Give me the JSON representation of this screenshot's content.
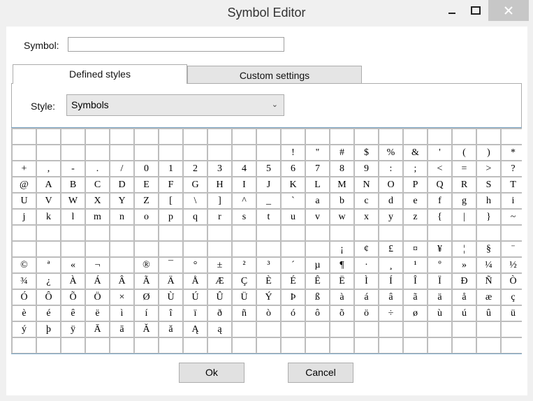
{
  "window": {
    "title": "Symbol Editor"
  },
  "symbol": {
    "label": "Symbol:",
    "value": ""
  },
  "tabs": [
    {
      "label": "Defined styles"
    },
    {
      "label": "Custom settings"
    }
  ],
  "style": {
    "label": "Style:",
    "selected": "Symbols"
  },
  "grid": {
    "rows": [
      [
        "",
        "",
        "",
        "",
        "",
        "",
        "",
        "",
        "",
        "",
        "",
        "",
        "",
        "",
        "",
        "",
        "",
        "",
        "",
        "",
        ""
      ],
      [
        "",
        "",
        "",
        "",
        "",
        "",
        "",
        "",
        "",
        "",
        "",
        "!",
        "\"",
        "#",
        "$",
        "%",
        "&",
        "'",
        "(",
        ")",
        "*"
      ],
      [
        "+",
        ",",
        "-",
        ".",
        "/",
        "0",
        "1",
        "2",
        "3",
        "4",
        "5",
        "6",
        "7",
        "8",
        "9",
        ":",
        ";",
        "<",
        "=",
        ">",
        "?"
      ],
      [
        "@",
        "A",
        "B",
        "C",
        "D",
        "E",
        "F",
        "G",
        "H",
        "I",
        "J",
        "K",
        "L",
        "M",
        "N",
        "O",
        "P",
        "Q",
        "R",
        "S",
        "T"
      ],
      [
        "U",
        "V",
        "W",
        "X",
        "Y",
        "Z",
        "[",
        "\\",
        "]",
        "^",
        "_",
        "`",
        "a",
        "b",
        "c",
        "d",
        "e",
        "f",
        "g",
        "h",
        "i"
      ],
      [
        "j",
        "k",
        "l",
        "m",
        "n",
        "o",
        "p",
        "q",
        "r",
        "s",
        "t",
        "u",
        "v",
        "w",
        "x",
        "y",
        "z",
        "{",
        "|",
        "}",
        "~"
      ],
      [
        "",
        "",
        "",
        "",
        "",
        "",
        "",
        "",
        "",
        "",
        "",
        "",
        "",
        "",
        "",
        "",
        "",
        "",
        "",
        "",
        ""
      ],
      [
        "",
        "",
        "",
        "",
        "",
        "",
        "",
        "",
        "",
        "",
        "",
        "",
        "",
        "¡",
        "¢",
        "£",
        "¤",
        "¥",
        "¦",
        "§",
        "¨"
      ],
      [
        "©",
        "ª",
        "«",
        "¬",
        "",
        "®",
        "¯",
        "°",
        "±",
        "²",
        "³",
        "´",
        "µ",
        "¶",
        "·",
        "¸",
        "¹",
        "º",
        "»",
        "¼",
        "½"
      ],
      [
        "¾",
        "¿",
        "À",
        "Á",
        "Â",
        "Ã",
        "Ä",
        "Å",
        "Æ",
        "Ç",
        "È",
        "É",
        "Ê",
        "Ë",
        "Ì",
        "Í",
        "Î",
        "Ï",
        "Ð",
        "Ñ",
        "Ò"
      ],
      [
        "Ó",
        "Ô",
        "Õ",
        "Ö",
        "×",
        "Ø",
        "Ù",
        "Ú",
        "Û",
        "Ü",
        "Ý",
        "Þ",
        "ß",
        "à",
        "á",
        "â",
        "ã",
        "ä",
        "å",
        "æ",
        "ç"
      ],
      [
        "è",
        "é",
        "ê",
        "ë",
        "ì",
        "í",
        "î",
        "ï",
        "ð",
        "ñ",
        "ò",
        "ó",
        "ô",
        "õ",
        "ö",
        "÷",
        "ø",
        "ù",
        "ú",
        "û",
        "ü"
      ],
      [
        "ý",
        "þ",
        "ÿ",
        "Ā",
        "ā",
        "Ă",
        "ă",
        "Ą",
        "ą",
        "",
        "",
        "",
        "",
        "",
        "",
        "",
        "",
        "",
        "",
        "",
        ""
      ],
      [
        "",
        "",
        "",
        "",
        "",
        "",
        "",
        "",
        "",
        "",
        "",
        "",
        "",
        "",
        "",
        "",
        "",
        "",
        "",
        "",
        ""
      ]
    ]
  },
  "buttons": {
    "ok": "Ok",
    "cancel": "Cancel"
  }
}
